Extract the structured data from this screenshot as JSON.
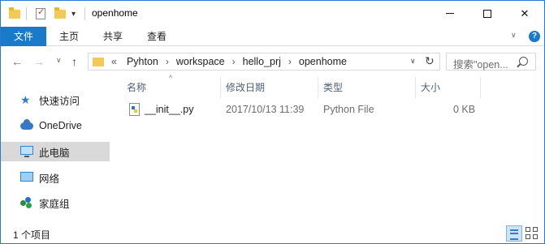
{
  "window": {
    "title": "openhome"
  },
  "titlebar": {
    "quick_access_icons": [
      "folder-icon",
      "properties-icon",
      "new-folder-icon",
      "customize-dropdown-icon"
    ],
    "min_icon": "minimize",
    "max_icon": "maximize",
    "close_icon": "✕"
  },
  "ribbon": {
    "tabs": [
      {
        "label": "文件"
      },
      {
        "label": "主页"
      },
      {
        "label": "共享"
      },
      {
        "label": "查看"
      }
    ],
    "expand_icon": "∨",
    "help_icon": "?"
  },
  "nav": {
    "back_icon": "←",
    "forward_icon": "→",
    "recent_icon": "∨",
    "up_icon": "↑",
    "overflow": "«",
    "breadcrumbs": [
      "Pyhton",
      "workspace",
      "hello_prj",
      "openhome"
    ],
    "crumb_sep": "›",
    "address_dropdown_icon": "∨",
    "refresh_icon": "↻",
    "search_placeholder": "搜索\"open..."
  },
  "sidebar": {
    "items": [
      {
        "label": "快速访问",
        "icon": "star-icon",
        "selected": false
      },
      {
        "label": "OneDrive",
        "icon": "cloud-icon",
        "selected": false
      },
      {
        "label": "此电脑",
        "icon": "computer-icon",
        "selected": true
      },
      {
        "label": "网络",
        "icon": "network-icon",
        "selected": false
      },
      {
        "label": "家庭组",
        "icon": "homegroup-icon",
        "selected": false
      }
    ]
  },
  "content": {
    "sort_caret": "^",
    "columns": [
      "名称",
      "修改日期",
      "类型",
      "大小"
    ],
    "rows": [
      {
        "name": "__init__.py",
        "date": "2017/10/13 11:39",
        "type": "Python File",
        "size": "0 KB",
        "icon": "python-file-icon"
      }
    ]
  },
  "status": {
    "text": "1 个项目",
    "views": [
      "details-view",
      "large-icons-view"
    ]
  },
  "colors": {
    "accent": "#1979ca",
    "selection": "#d9d9d9",
    "border": "#2b79d6"
  }
}
